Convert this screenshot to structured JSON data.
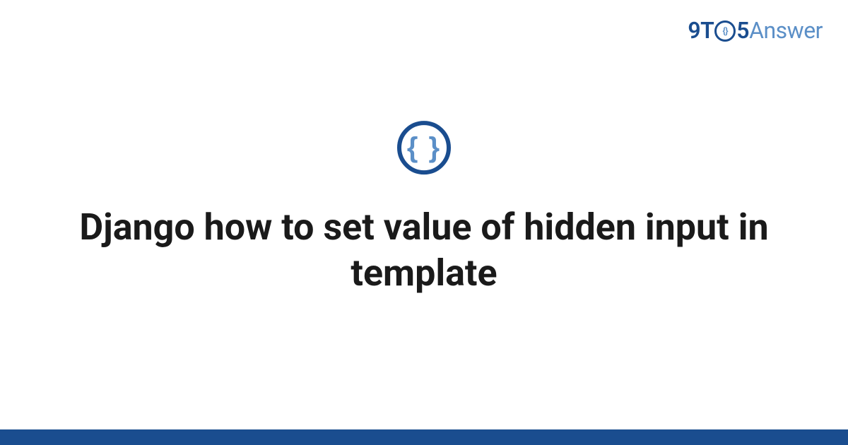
{
  "logo": {
    "part1": "9T",
    "circle_inner": "{}",
    "part2": "5",
    "part3": "Answer"
  },
  "category_icon": {
    "name": "code-braces-icon",
    "glyph": "{ }"
  },
  "title": "Django how to set value of hidden input in template",
  "colors": {
    "primary": "#1a4d8f",
    "accent": "#5b8fc7"
  }
}
